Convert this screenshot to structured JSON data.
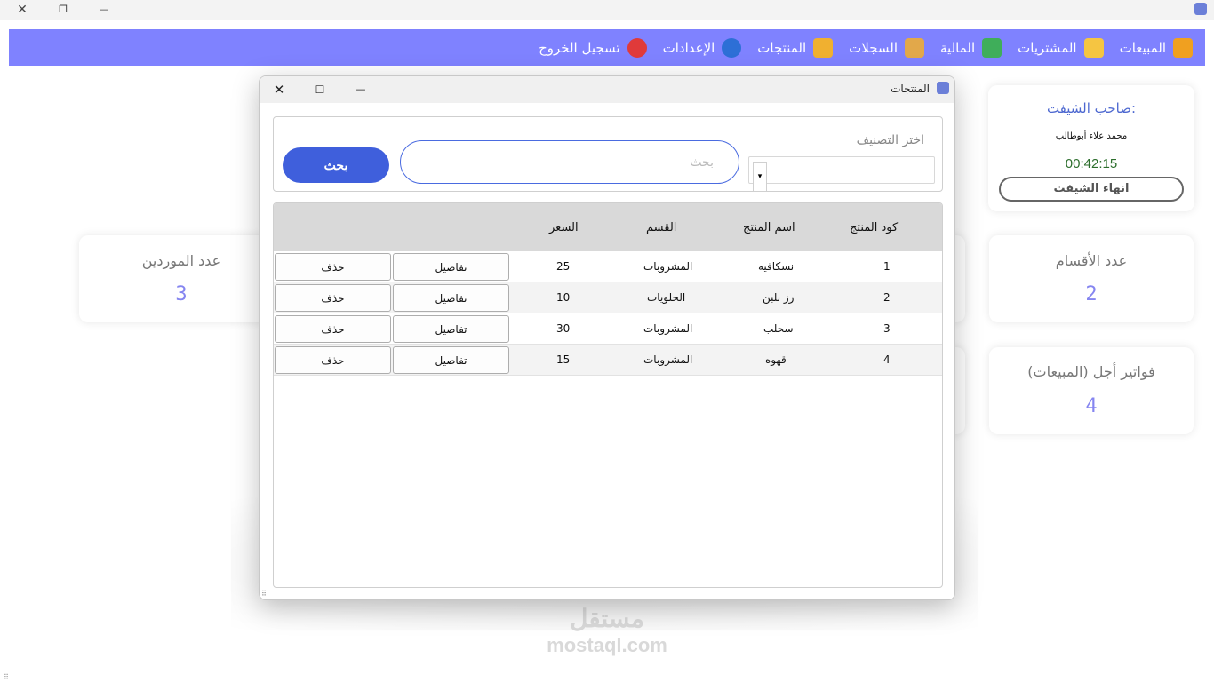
{
  "outer_window": {
    "close_glyph": "✕",
    "restore_glyph": "❐",
    "minimize_glyph": "—"
  },
  "nav": {
    "items": [
      {
        "label": "المبيعات",
        "icon": "chart-up-icon",
        "color": "#f0a020"
      },
      {
        "label": "المشتريات",
        "icon": "cart-icon",
        "color": "#f5c542"
      },
      {
        "label": "المالية",
        "icon": "money-hand-icon",
        "color": "#3fae5a"
      },
      {
        "label": "السجلات",
        "icon": "register-icon",
        "color": "#e2a84a"
      },
      {
        "label": "المنتجات",
        "icon": "boxes-icon",
        "color": "#f0b030"
      },
      {
        "label": "الإعدادات",
        "icon": "gear-icon",
        "color": "#2d6fd6"
      },
      {
        "label": "تسجيل الخروج",
        "icon": "logout-icon",
        "color": "#e03a3a"
      }
    ]
  },
  "shift": {
    "owner_label": "صاحب الشيفت:",
    "owner_name": "محمد علاء أبوطالب",
    "elapsed": "00:42:15",
    "end_button": "انهاء الشيفت"
  },
  "stats": {
    "sections_title": "عدد الأقسام",
    "sections_value": "2",
    "credit_title": "فواتير أجل (المبيعات)",
    "credit_value": "4",
    "suppliers_title": "عدد الموردين",
    "suppliers_value": "3"
  },
  "watermark": {
    "logo": "مستقل",
    "url": "mostaql.com"
  },
  "dialog": {
    "title": "المنتجات",
    "close_glyph": "✕",
    "maximize_glyph": "☐",
    "minimize_glyph": "—",
    "category_legend": "اختر التصنيف",
    "combo_arrow": "▾",
    "search_placeholder": "بحث",
    "search_button": "بحث",
    "resize_glyph": "⠿",
    "columns": {
      "code": "كود المنتج",
      "name": "اسم المنتج",
      "section": "القسم",
      "price": "السعر"
    },
    "details_label": "تفاصيل",
    "delete_label": "حذف",
    "rows": [
      {
        "code": "1",
        "name": "نسكافيه",
        "section": "المشروبات",
        "price": "25"
      },
      {
        "code": "2",
        "name": "رز بلبن",
        "section": "الحلويات",
        "price": "10"
      },
      {
        "code": "3",
        "name": "سحلب",
        "section": "المشروبات",
        "price": "30"
      },
      {
        "code": "4",
        "name": "قهوه",
        "section": "المشروبات",
        "price": "15"
      }
    ]
  }
}
